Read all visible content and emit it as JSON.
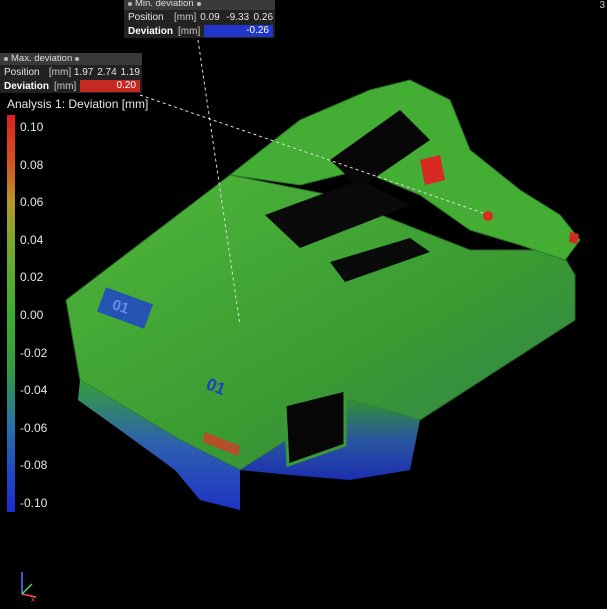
{
  "corner_label": "3",
  "min_deviation": {
    "title": "Min. deviation",
    "position_label": "Position",
    "position_unit": "[mm]",
    "position": [
      "0.09",
      "-9.33",
      "0.26"
    ],
    "deviation_label": "Deviation",
    "deviation_unit": "[mm]",
    "deviation_value": "-0.26",
    "bar_color": "#1f36c9"
  },
  "max_deviation": {
    "title": "Max. deviation",
    "position_label": "Position",
    "position_unit": "[mm]",
    "position": [
      "1.97",
      "2.74",
      "1.19"
    ],
    "deviation_label": "Deviation",
    "deviation_unit": "[mm]",
    "deviation_value": "0.20",
    "bar_color": "#c62a22"
  },
  "legend": {
    "title": "Analysis 1: Deviation [mm]",
    "ticks": [
      "0.10",
      "0.08",
      "0.06",
      "0.04",
      "0.02",
      "0.00",
      "-0.02",
      "-0.04",
      "-0.06",
      "-0.08",
      "-0.10"
    ],
    "colors": {
      "top": "#d7261f",
      "upper": "#c98a2a",
      "mid": "#3fae2d",
      "lower": "#1d6bb0",
      "bottom": "#1c2fc8"
    }
  },
  "part": {
    "label_front": "01",
    "label_side": "01",
    "fill_color": "#39a62a"
  },
  "icons": {
    "axis_triad": "axis-triad-icon"
  }
}
